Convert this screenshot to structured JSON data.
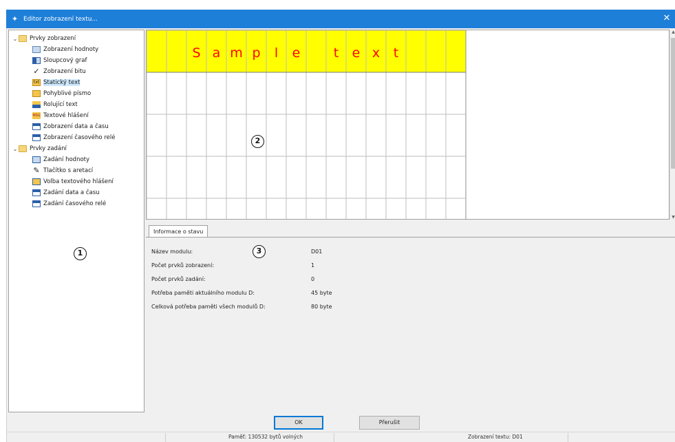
{
  "window": {
    "title": "Editor zobrazení textu...",
    "close_glyph": "✕"
  },
  "tree": {
    "groups": [
      {
        "label": "Prvky zobrazení",
        "expanded": true,
        "items": [
          {
            "label": "Zobrazení hodnoty",
            "icon": "value-display-icon"
          },
          {
            "label": "Sloupcový graf",
            "icon": "bar-graph-icon"
          },
          {
            "label": "Zobrazení bitu",
            "icon": "checkmark-icon"
          },
          {
            "label": "Statický text",
            "icon": "static-text-icon",
            "selected": true
          },
          {
            "label": "Pohyblivé písmo",
            "icon": "moving-font-icon"
          },
          {
            "label": "Rolující text",
            "icon": "scrolling-text-icon"
          },
          {
            "label": "Textové hlášení",
            "icon": "text-message-icon"
          },
          {
            "label": "Zobrazení data a času",
            "icon": "calendar-icon"
          },
          {
            "label": "Zobrazení časového relé",
            "icon": "timer-relay-icon"
          }
        ]
      },
      {
        "label": "Prvky zadání",
        "expanded": true,
        "items": [
          {
            "label": "Zadání hodnoty",
            "icon": "value-input-icon"
          },
          {
            "label": "Tlačítko s aretací",
            "icon": "pen-icon"
          },
          {
            "label": "Volba textového hlášení",
            "icon": "message-choice-icon"
          },
          {
            "label": "Zadání data a času",
            "icon": "calendar-input-icon"
          },
          {
            "label": "Zadání časového relé",
            "icon": "timer-relay-input-icon"
          }
        ]
      }
    ]
  },
  "canvas": {
    "sample_chars": [
      "S",
      "a",
      "m",
      "p",
      "l",
      "e",
      "",
      "t",
      "e",
      "x",
      "t"
    ],
    "highlight_color": "#ffff00",
    "text_color": "#ff0000",
    "cols": 16,
    "rows": 4
  },
  "callouts": [
    "1",
    "2",
    "3"
  ],
  "status_info": {
    "tab_label": "Informace o stavu",
    "rows": [
      {
        "label": "Název modulu:",
        "value": "D01"
      },
      {
        "label": "Počet prvků zobrazení:",
        "value": "1"
      },
      {
        "label": "Počet prvků zadání:",
        "value": "0"
      },
      {
        "label": "Potřeba paměti aktuálního modulu D:",
        "value": "45 byte"
      },
      {
        "label": "Celková potřeba paměti všech modulů D:",
        "value": "80 byte"
      }
    ]
  },
  "buttons": {
    "ok": "OK",
    "cancel": "Přerušit"
  },
  "statusbar": {
    "memory": "Paměť: 130532 bytů volných",
    "mode": "Zobrazení textu: D01"
  }
}
